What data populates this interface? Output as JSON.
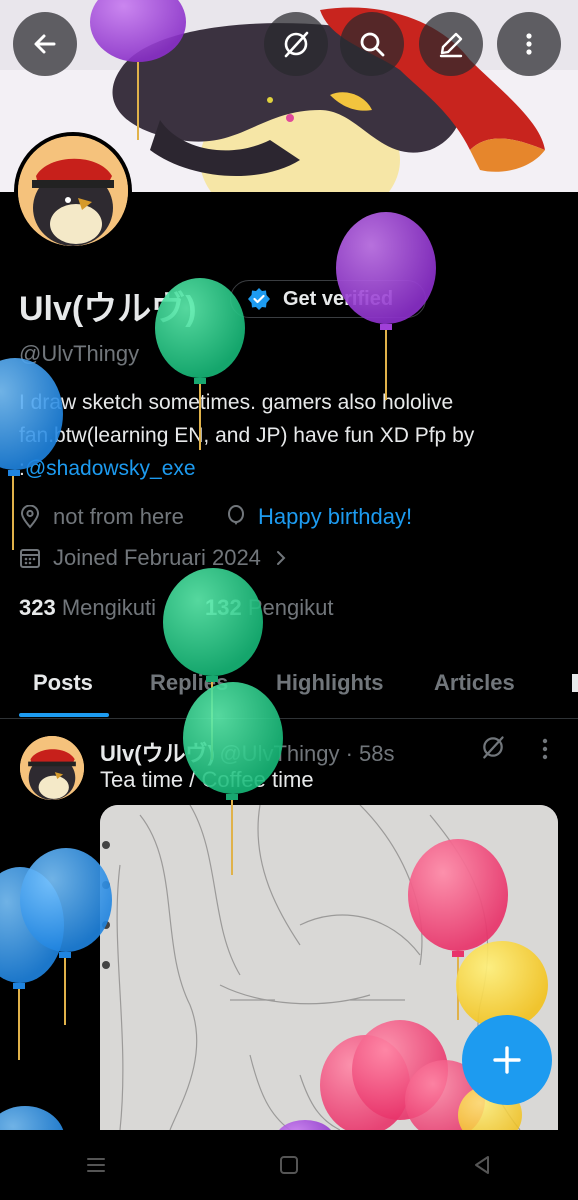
{
  "profile": {
    "display_name": "Ulv(ウルヴ)",
    "handle": "@UlvThingy",
    "verify_button": "Get verified",
    "bio_text": "I draw sketch sometimes. gamers also hololive fan.btw(learning EN, and JP) have fun XD  Pfp by :",
    "bio_link": "@shadowsky_exe",
    "location": "not from here",
    "birthday": "Happy birthday!",
    "joined": "Joined Februari 2024",
    "following_count": "323",
    "following_label": "Mengikuti",
    "followers_count": "132",
    "followers_label": "Pengikut"
  },
  "tabs": [
    "Posts",
    "Replies",
    "Highlights",
    "Articles"
  ],
  "post": {
    "name": "Ulv(ウルヴ)",
    "handle_time": "@UlvThingy · 58s",
    "text": "Tea time / Coffee time"
  },
  "icons": {
    "back": "arrow-left-icon",
    "grok": "slash-circle-icon",
    "search": "search-icon",
    "edit": "pencil-icon",
    "more": "vertical-dots-icon",
    "fab": "plus-icon"
  },
  "colors": {
    "accent": "#1d9bf0",
    "background": "#000000",
    "muted": "#71767b",
    "verified": "#1d9bf0"
  }
}
